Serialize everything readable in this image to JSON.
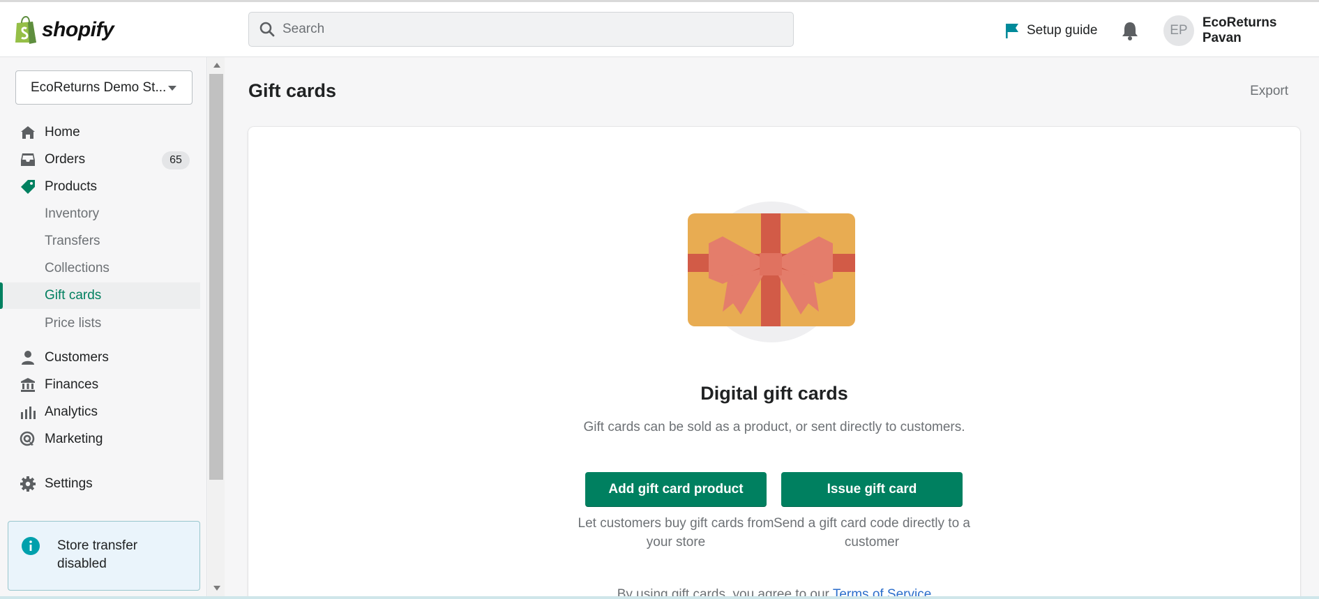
{
  "brand": {
    "logo_text": "shopify",
    "accent": "#008060"
  },
  "header": {
    "search_placeholder": "Search",
    "setup_guide_label": "Setup guide",
    "user_initials": "EP",
    "user_name": "EcoReturns Pavan"
  },
  "sidebar": {
    "store_name": "EcoReturns Demo St...",
    "items": [
      {
        "label": "Home",
        "icon": "home-icon"
      },
      {
        "label": "Orders",
        "icon": "inbox-icon",
        "badge": "65"
      },
      {
        "label": "Products",
        "icon": "tag-icon"
      },
      {
        "label": "Inventory"
      },
      {
        "label": "Transfers"
      },
      {
        "label": "Collections"
      },
      {
        "label": "Gift cards",
        "active": true
      },
      {
        "label": "Price lists"
      },
      {
        "label": "Customers",
        "icon": "person-icon"
      },
      {
        "label": "Finances",
        "icon": "bank-icon"
      },
      {
        "label": "Analytics",
        "icon": "chart-bar-icon"
      },
      {
        "label": "Marketing",
        "icon": "target-icon"
      },
      {
        "label": "Settings",
        "icon": "gear-icon"
      }
    ],
    "notice": {
      "text": "Store transfer disabled",
      "icon": "info-icon"
    }
  },
  "main": {
    "title": "Gift cards",
    "export_label": "Export",
    "empty_state": {
      "title": "Digital gift cards",
      "description": "Gift cards can be sold as a product, or sent directly to customers.",
      "primary_action": "Add gift card product",
      "primary_help": "Let customers buy gift cards from your store",
      "secondary_action": "Issue gift card",
      "secondary_help": "Send a gift card code directly to a customer",
      "terms_prefix": "By using gift cards, you agree to our ",
      "terms_link": "Terms of Service"
    }
  }
}
